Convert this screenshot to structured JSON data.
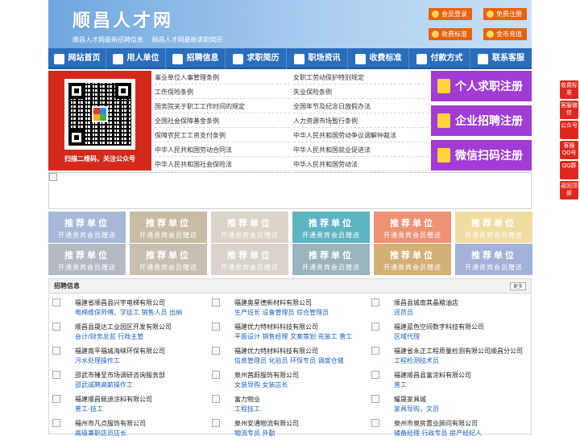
{
  "header": {
    "site_title": "顺昌人才网",
    "subtitle_links": [
      "顺昌人才网最新招聘信息",
      "顺昌人才网最新求职简历"
    ],
    "buttons": [
      {
        "label": "会员登录",
        "icon": "user-icon"
      },
      {
        "label": "免费注册",
        "icon": "register-icon"
      },
      {
        "label": "收费标准",
        "icon": "price-icon"
      },
      {
        "label": "金币充值",
        "icon": "coin-icon"
      }
    ]
  },
  "nav": [
    {
      "label": "网站首页",
      "icon": "home-icon"
    },
    {
      "label": "用人单位",
      "icon": "building-icon"
    },
    {
      "label": "招聘信息",
      "icon": "recruit-icon"
    },
    {
      "label": "求职简历",
      "icon": "resume-icon"
    },
    {
      "label": "职场资讯",
      "icon": "news-icon"
    },
    {
      "label": "收费标准",
      "icon": "price-icon"
    },
    {
      "label": "付款方式",
      "icon": "payment-icon"
    },
    {
      "label": "联系客服",
      "icon": "phone-icon"
    }
  ],
  "qr": {
    "caption": "扫描二维码，关注公众号"
  },
  "laws": [
    "事业单位人事管理条例",
    "女职工劳动保护特别规定",
    "工伤保险条例",
    "失业保险条例",
    "国务院关于职工工作时间的规定",
    "全国年节及纪念日放假办法",
    "全国社会保障基金条例",
    "人力资源市场暂行条例",
    "保障农民工工资支付条例",
    "中华人民共和国劳动争议调解仲裁法",
    "中华人民共和国劳动合同法",
    "中华人民共和国就业促进法",
    "中华人民共和国社会保险法",
    "中华人民共和国劳动法"
  ],
  "register": [
    {
      "label": "个人求职注册",
      "icon": "person-icon"
    },
    {
      "label": "企业招聘注册",
      "icon": "company-icon"
    },
    {
      "label": "微信扫码注册",
      "icon": "wechat-icon"
    }
  ],
  "tiles": {
    "title": "推荐单位",
    "subtitle": "开通贵宾会员赠送",
    "colors": [
      "#a7b8d8",
      "#c9bca4",
      "#dcd4c8",
      "#5fb4c2",
      "#ee9276",
      "#f1dca2",
      "#b4b9c4",
      "#c8bfb2",
      "#d9d3cc",
      "#9ab4bc",
      "#d3b076",
      "#a4b1d8"
    ]
  },
  "jobs": {
    "heading": "招聘信息",
    "more": "更多",
    "items": [
      {
        "company": "福建省顺昌县兴宇电梯有限公司",
        "positions": "电梯维保师傅、学徒工 销售人员 出纳"
      },
      {
        "company": "福建奥星德新材料有限公司",
        "positions": "生产班长 设备管理员 综合管理员"
      },
      {
        "company": "顺昌县城南其晶粮油店",
        "positions": "送货员"
      },
      {
        "company": "顺昌县晟达工业园区开发有限公司",
        "positions": "会计/财务总监 行政主管"
      },
      {
        "company": "福建优力特材料科技有限公司",
        "positions": "平面设计 销售经理 文案策划 充装工 普工"
      },
      {
        "company": "福建蓝色空间数字科技有限公司",
        "positions": "区域代理"
      },
      {
        "company": "福建南平福城海峡环保有限公司",
        "positions": "污水处理操作工"
      },
      {
        "company": "福建优力特材料科技有限公司",
        "positions": "信息管理员 化验员 环保专员 调度仓储"
      },
      {
        "company": "福建省永正工程质量检测有限公司顺昌分公司",
        "positions": "工程检测技术员"
      },
      {
        "company": "邵武市臻至市场调研咨询服务部",
        "positions": "邵武诚聘高薪操作工"
      },
      {
        "company": "泉州茜蔚服饰有限公司",
        "positions": "女装导购 女装店长"
      },
      {
        "company": "福建顺昌县富涂料有限公司",
        "positions": "普工"
      },
      {
        "company": "福建顺昌佩迪涂料有限公司",
        "positions": "普工-技工"
      },
      {
        "company": "富力物业",
        "positions": "工程技工"
      },
      {
        "company": "耀晟家具城",
        "positions": "家具导购，文员"
      },
      {
        "company": "福州市凡点服饰有限公司",
        "positions": "高级兼职店员店长"
      },
      {
        "company": "泉州安通物流有限公司",
        "positions": "物流专员 外勤"
      },
      {
        "company": "泉州市泉房置业顾问有限公司",
        "positions": "储备经理 行政专员 房产经纪人"
      }
    ]
  },
  "sidebar": [
    "收费标准",
    "客服微信",
    "公众号",
    "客服QQ号",
    "QQ群",
    "返回顶部"
  ]
}
